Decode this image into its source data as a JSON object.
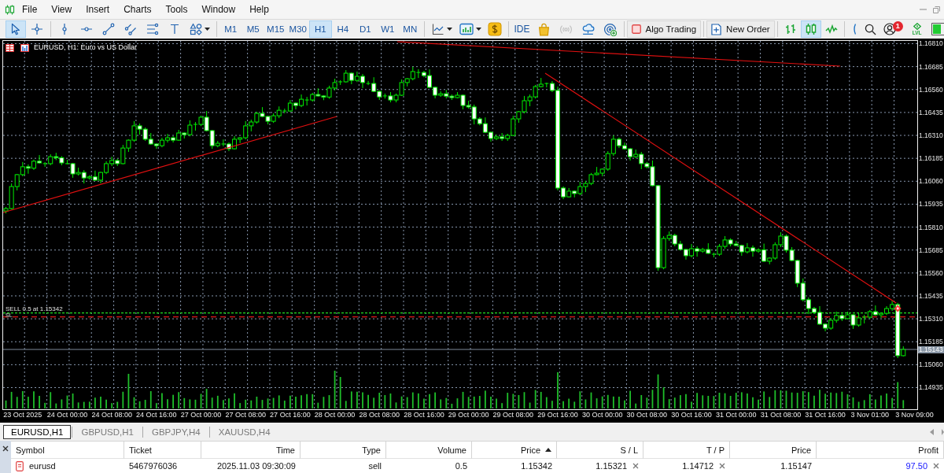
{
  "menu_bar": {
    "items": [
      "File",
      "View",
      "Insert",
      "Charts",
      "Tools",
      "Window",
      "Help"
    ]
  },
  "toolbar": {
    "drawing_tools": [
      {
        "selected": true
      },
      {
        "selected": false
      },
      {
        "selected": false
      },
      {
        "selected": false
      },
      {
        "selected": false
      },
      {
        "selected": false
      },
      {
        "selected": false
      },
      {
        "selected": false
      },
      {
        "selected": false
      }
    ],
    "timeframes": [
      {
        "label": "M1",
        "selected": false
      },
      {
        "label": "M5",
        "selected": false
      },
      {
        "label": "M15",
        "selected": false
      },
      {
        "label": "M30",
        "selected": false
      },
      {
        "label": "H1",
        "selected": true
      },
      {
        "label": "H4",
        "selected": false
      },
      {
        "label": "D1",
        "selected": false
      },
      {
        "label": "W1",
        "selected": false
      },
      {
        "label": "MN",
        "selected": false
      }
    ],
    "services": [
      {
        "label": "IDE",
        "disabled": false
      },
      {
        "disabled": false
      },
      {
        "disabled": true
      },
      {
        "disabled": false
      },
      {
        "disabled": false
      }
    ],
    "algo_trading": {
      "label": "Algo Trading",
      "on": false
    },
    "new_order": {
      "label": "New Order"
    },
    "chart_modes": [
      {
        "selected": false
      },
      {
        "selected": true
      },
      {
        "selected": false
      }
    ],
    "notification_count": "1",
    "level_label": "LVL"
  },
  "chart": {
    "chart_data": {
      "type": "candlestick",
      "title": "EURUSD, H1: Euro vs US Dollar",
      "grid": true,
      "categories": [
        null,
        null,
        null,
        "23 Oct 2025",
        null,
        null,
        null,
        null,
        null,
        null,
        null,
        "24 Oct 00:00",
        null,
        null,
        null,
        null,
        null,
        null,
        null,
        "24 Oct 08:00",
        null,
        null,
        null,
        null,
        null,
        null,
        null,
        "24 Oct 16:00",
        null,
        null,
        null,
        null,
        null,
        null,
        null,
        "27 Oct 00:00",
        null,
        null,
        null,
        null,
        null,
        null,
        null,
        "27 Oct 08:00",
        null,
        null,
        null,
        null,
        null,
        null,
        null,
        "27 Oct 16:00",
        null,
        null,
        null,
        null,
        null,
        null,
        null,
        "28 Oct 00:00",
        null,
        null,
        null,
        null,
        null,
        null,
        null,
        "28 Oct 08:00",
        null,
        null,
        null,
        null,
        null,
        null,
        null,
        "28 Oct 16:00",
        null,
        null,
        null,
        null,
        null,
        null,
        null,
        "29 Oct 00:00",
        null,
        null,
        null,
        null,
        null,
        null,
        null,
        "29 Oct 08:00",
        null,
        null,
        null,
        null,
        null,
        null,
        null,
        "29 Oct 16:00",
        null,
        null,
        null,
        null,
        null,
        null,
        null,
        "30 Oct 00:00",
        null,
        null,
        null,
        null,
        null,
        null,
        null,
        "30 Oct 08:00",
        null,
        null,
        null,
        null,
        null,
        null,
        null,
        "30 Oct 16:00",
        null,
        null,
        null,
        null,
        null,
        null,
        null,
        "31 Oct 00:00",
        null,
        null,
        null,
        null,
        null,
        null,
        null,
        "31 Oct 08:00",
        null,
        null,
        null,
        null,
        null,
        null,
        null,
        "31 Oct 16:00",
        null,
        null,
        null,
        null,
        null,
        null,
        null,
        "3 Nov 01:00",
        null,
        null,
        null,
        null,
        null,
        null,
        null,
        "3 Nov 09:00"
      ],
      "ohlc": [
        [
          1.15898,
          1.1592,
          1.15885,
          1.15911
        ],
        [
          1.15911,
          1.16048,
          1.15907,
          1.16031
        ],
        [
          1.16031,
          1.161,
          1.1601,
          1.16096
        ],
        [
          1.16096,
          1.16165,
          1.16087,
          1.16139
        ],
        [
          1.16139,
          1.16152,
          1.16101,
          1.16131
        ],
        [
          1.16131,
          1.16178,
          1.16122,
          1.16169
        ],
        [
          1.16169,
          1.16203,
          1.16156,
          1.1616
        ],
        [
          1.1616,
          1.16164,
          1.16139,
          1.16156
        ],
        [
          1.16156,
          1.16207,
          1.16147,
          1.16194
        ],
        [
          1.16194,
          1.16215,
          1.16175,
          1.16188
        ],
        [
          1.16188,
          1.16197,
          1.16147,
          1.1616
        ],
        [
          1.1616,
          1.16177,
          1.16152,
          1.16156
        ],
        [
          1.16156,
          1.1616,
          1.16079,
          1.161
        ],
        [
          1.161,
          1.16134,
          1.16091,
          1.16108
        ],
        [
          1.16108,
          1.16121,
          1.16048,
          1.16078
        ],
        [
          1.16078,
          1.16093,
          1.16069,
          1.16084
        ],
        [
          1.16084,
          1.16118,
          1.16062,
          1.16066
        ],
        [
          1.16066,
          1.16112,
          1.16049,
          1.16108
        ],
        [
          1.16108,
          1.16169,
          1.16099,
          1.16156
        ],
        [
          1.16156,
          1.16194,
          1.16143,
          1.16173
        ],
        [
          1.16173,
          1.16182,
          1.16143,
          1.16156
        ],
        [
          1.16156,
          1.16258,
          1.16152,
          1.16241
        ],
        [
          1.16241,
          1.16288,
          1.1622,
          1.16284
        ],
        [
          1.16284,
          1.16388,
          1.16275,
          1.16362
        ],
        [
          1.16362,
          1.16375,
          1.16314,
          1.16344
        ],
        [
          1.16344,
          1.16353,
          1.1628,
          1.16289
        ],
        [
          1.16289,
          1.16323,
          1.16259,
          1.16263
        ],
        [
          1.16263,
          1.16267,
          1.16237,
          1.16254
        ],
        [
          1.16254,
          1.16297,
          1.16245,
          1.16284
        ],
        [
          1.16284,
          1.16318,
          1.16271,
          1.16297
        ],
        [
          1.16297,
          1.16306,
          1.16271,
          1.16284
        ],
        [
          1.16284,
          1.1634,
          1.1628,
          1.16323
        ],
        [
          1.16323,
          1.16327,
          1.16293,
          1.16314
        ],
        [
          1.16314,
          1.16392,
          1.16305,
          1.16366
        ],
        [
          1.16366,
          1.16383,
          1.16336,
          1.1637
        ],
        [
          1.1637,
          1.16418,
          1.16361,
          1.16409
        ],
        [
          1.16409,
          1.16443,
          1.16332,
          1.16336
        ],
        [
          1.16336,
          1.1634,
          1.16237,
          1.16254
        ],
        [
          1.16254,
          1.1628,
          1.16245,
          1.16267
        ],
        [
          1.16267,
          1.16288,
          1.1625,
          1.16263
        ],
        [
          1.16263,
          1.16272,
          1.16224,
          1.16237
        ],
        [
          1.16237,
          1.16306,
          1.16233,
          1.16289
        ],
        [
          1.16289,
          1.16301,
          1.16268,
          1.16297
        ],
        [
          1.16297,
          1.16388,
          1.16288,
          1.16362
        ],
        [
          1.16362,
          1.16396,
          1.16332,
          1.16383
        ],
        [
          1.16383,
          1.16439,
          1.16374,
          1.1643
        ],
        [
          1.1643,
          1.16464,
          1.16409,
          1.16413
        ],
        [
          1.16413,
          1.16417,
          1.1637,
          1.16387
        ],
        [
          1.16387,
          1.1643,
          1.16378,
          1.16417
        ],
        [
          1.16417,
          1.16468,
          1.16404,
          1.16447
        ],
        [
          1.16447,
          1.16456,
          1.1643,
          1.16443
        ],
        [
          1.16443,
          1.16503,
          1.16439,
          1.16486
        ],
        [
          1.16486,
          1.1649,
          1.16452,
          1.16473
        ],
        [
          1.16473,
          1.16533,
          1.16464,
          1.16507
        ],
        [
          1.16507,
          1.1652,
          1.16473,
          1.16503
        ],
        [
          1.16503,
          1.16542,
          1.16494,
          1.16533
        ],
        [
          1.16533,
          1.16567,
          1.16521,
          1.16525
        ],
        [
          1.16525,
          1.16529,
          1.16502,
          1.16519
        ],
        [
          1.16519,
          1.16581,
          1.1651,
          1.16568
        ],
        [
          1.16568,
          1.16619,
          1.16555,
          1.16598
        ],
        [
          1.16598,
          1.16611,
          1.16585,
          1.16602
        ],
        [
          1.16602,
          1.16666,
          1.16598,
          1.16649
        ],
        [
          1.16649,
          1.16653,
          1.16589,
          1.1661
        ],
        [
          1.1661,
          1.16658,
          1.16601,
          1.16632
        ],
        [
          1.16632,
          1.16645,
          1.16568,
          1.16598
        ],
        [
          1.16598,
          1.16607,
          1.16584,
          1.16593
        ],
        [
          1.16593,
          1.16627,
          1.16546,
          1.1655
        ],
        [
          1.1655,
          1.16554,
          1.16503,
          1.1652
        ],
        [
          1.1652,
          1.16538,
          1.16511,
          1.16525
        ],
        [
          1.16525,
          1.16546,
          1.1649,
          1.16503
        ],
        [
          1.16503,
          1.16538,
          1.1649,
          1.16529
        ],
        [
          1.16529,
          1.16615,
          1.16525,
          1.16598
        ],
        [
          1.16598,
          1.16623,
          1.16577,
          1.16619
        ],
        [
          1.16619,
          1.16684,
          1.1661,
          1.16658
        ],
        [
          1.16658,
          1.16671,
          1.16623,
          1.16653
        ],
        [
          1.16653,
          1.16662,
          1.16627,
          1.16636
        ],
        [
          1.16636,
          1.1667,
          1.16568,
          1.16572
        ],
        [
          1.16572,
          1.16576,
          1.16512,
          1.16529
        ],
        [
          1.16529,
          1.1655,
          1.1652,
          1.16537
        ],
        [
          1.16537,
          1.16558,
          1.16511,
          1.16524
        ],
        [
          1.16524,
          1.16533,
          1.16503,
          1.16516
        ],
        [
          1.16516,
          1.16546,
          1.16512,
          1.16529
        ],
        [
          1.16529,
          1.16533,
          1.16452,
          1.16473
        ],
        [
          1.16473,
          1.16499,
          1.16456,
          1.16465
        ],
        [
          1.16465,
          1.16478,
          1.1637,
          1.164
        ],
        [
          1.164,
          1.16409,
          1.16365,
          1.16374
        ],
        [
          1.16374,
          1.16408,
          1.16323,
          1.16327
        ],
        [
          1.16327,
          1.16331,
          1.16276,
          1.16293
        ],
        [
          1.16293,
          1.16315,
          1.16284,
          1.16302
        ],
        [
          1.16302,
          1.16323,
          1.1628,
          1.16293
        ],
        [
          1.16293,
          1.16319,
          1.1628,
          1.1631
        ],
        [
          1.1631,
          1.16417,
          1.16306,
          1.164
        ],
        [
          1.164,
          1.16443,
          1.16379,
          1.16439
        ],
        [
          1.16439,
          1.16525,
          1.1643,
          1.16499
        ],
        [
          1.16499,
          1.16533,
          1.16469,
          1.1652
        ],
        [
          1.1652,
          1.16585,
          1.16511,
          1.16576
        ],
        [
          1.16576,
          1.16623,
          1.16572,
          1.16589
        ],
        [
          1.16589,
          1.16597,
          1.16572,
          1.16593
        ],
        [
          1.16593,
          1.16606,
          1.16546,
          1.16555
        ],
        [
          1.16555,
          1.16576,
          1.1601,
          1.16023
        ],
        [
          1.16023,
          1.16032,
          1.15962,
          1.15975
        ],
        [
          1.15975,
          1.16023,
          1.15971,
          1.16006
        ],
        [
          1.16006,
          1.1601,
          1.15972,
          1.15993
        ],
        [
          1.15993,
          1.16057,
          1.15984,
          1.16031
        ],
        [
          1.16031,
          1.16061,
          1.16001,
          1.16048
        ],
        [
          1.16048,
          1.16105,
          1.16039,
          1.16096
        ],
        [
          1.16096,
          1.16138,
          1.16092,
          1.16104
        ],
        [
          1.16104,
          1.1613,
          1.16087,
          1.16126
        ],
        [
          1.16126,
          1.16224,
          1.16117,
          1.16211
        ],
        [
          1.16211,
          1.1631,
          1.16198,
          1.16289
        ],
        [
          1.16289,
          1.16298,
          1.16241,
          1.16254
        ],
        [
          1.16254,
          1.16271,
          1.16233,
          1.16237
        ],
        [
          1.16237,
          1.16241,
          1.16173,
          1.16194
        ],
        [
          1.16194,
          1.16233,
          1.16185,
          1.16207
        ],
        [
          1.16207,
          1.1622,
          1.16126,
          1.16156
        ],
        [
          1.16156,
          1.16165,
          1.1613,
          1.16139
        ],
        [
          1.16139,
          1.16173,
          1.16032,
          1.16036
        ],
        [
          1.16036,
          1.1604,
          1.15572,
          1.15589
        ],
        [
          1.15589,
          1.15761,
          1.1558,
          1.15748
        ],
        [
          1.15748,
          1.15786,
          1.15735,
          1.15765
        ],
        [
          1.15765,
          1.15774,
          1.15705,
          1.15718
        ],
        [
          1.15718,
          1.15735,
          1.15684,
          1.15688
        ],
        [
          1.15688,
          1.15692,
          1.15633,
          1.15654
        ],
        [
          1.15654,
          1.15718,
          1.15645,
          1.15692
        ],
        [
          1.15692,
          1.15705,
          1.15649,
          1.15679
        ],
        [
          1.15679,
          1.15697,
          1.1567,
          1.15688
        ],
        [
          1.15688,
          1.15722,
          1.15663,
          1.15667
        ],
        [
          1.15667,
          1.15671,
          1.15645,
          1.15662
        ],
        [
          1.15662,
          1.15718,
          1.15653,
          1.15705
        ],
        [
          1.15705,
          1.15761,
          1.15692,
          1.1574
        ],
        [
          1.1574,
          1.15749,
          1.15705,
          1.15718
        ],
        [
          1.15718,
          1.15735,
          1.15706,
          1.1571
        ],
        [
          1.1571,
          1.15714,
          1.15654,
          1.15675
        ],
        [
          1.15675,
          1.15723,
          1.15666,
          1.15697
        ],
        [
          1.15697,
          1.1571,
          1.15649,
          1.15679
        ],
        [
          1.15679,
          1.15695,
          1.1567,
          1.15686
        ],
        [
          1.15686,
          1.1572,
          1.1562,
          1.15624
        ],
        [
          1.15624,
          1.15645,
          1.15607,
          1.15641
        ],
        [
          1.15641,
          1.15727,
          1.15632,
          1.15714
        ],
        [
          1.15714,
          1.15782,
          1.15701,
          1.15761
        ],
        [
          1.15761,
          1.1577,
          1.15671,
          1.15684
        ],
        [
          1.15684,
          1.15701,
          1.15624,
          1.15628
        ],
        [
          1.15628,
          1.15632,
          1.15483,
          1.15504
        ],
        [
          1.15504,
          1.1553,
          1.15405,
          1.15414
        ],
        [
          1.15414,
          1.15427,
          1.15336,
          1.15366
        ],
        [
          1.15366,
          1.15375,
          1.15336,
          1.15345
        ],
        [
          1.15345,
          1.15379,
          1.15277,
          1.15281
        ],
        [
          1.15281,
          1.15285,
          1.15242,
          1.15259
        ],
        [
          1.15259,
          1.15315,
          1.1525,
          1.15302
        ],
        [
          1.15302,
          1.15349,
          1.15289,
          1.15328
        ],
        [
          1.15328,
          1.15337,
          1.15298,
          1.15311
        ],
        [
          1.15311,
          1.15349,
          1.15307,
          1.15332
        ],
        [
          1.15332,
          1.15336,
          1.15255,
          1.15276
        ],
        [
          1.15276,
          1.15341,
          1.15267,
          1.15315
        ],
        [
          1.15315,
          1.15332,
          1.15285,
          1.15319
        ],
        [
          1.15319,
          1.15358,
          1.1531,
          1.15349
        ],
        [
          1.15349,
          1.15383,
          1.15328,
          1.15332
        ],
        [
          1.15332,
          1.15344,
          1.15315,
          1.1534
        ],
        [
          1.1534,
          1.15379,
          1.15331,
          1.15366
        ],
        [
          1.15366,
          1.15409,
          1.15353,
          1.15388
        ],
        [
          1.15388,
          1.15397,
          1.15096,
          1.15109
        ],
        [
          1.15109,
          1.1516,
          1.15105,
          1.15143
        ],
        null,
        null
      ],
      "ylim": [
        1.14817,
        1.16825
      ],
      "yticks": [
        {
          "value": 1.1681,
          "label": "1.16810"
        },
        {
          "value": 1.16685,
          "label": "1.16685"
        },
        {
          "value": 1.1656,
          "label": "1.16560"
        },
        {
          "value": 1.16435,
          "label": "1.16435"
        },
        {
          "value": 1.1631,
          "label": "1.16310"
        },
        {
          "value": 1.16185,
          "label": "1.16185"
        },
        {
          "value": 1.1606,
          "label": "1.16060"
        },
        {
          "value": 1.15935,
          "label": "1.15935"
        },
        {
          "value": 1.1581,
          "label": "1.15810"
        },
        {
          "value": 1.15685,
          "label": "1.15685"
        },
        {
          "value": 1.1556,
          "label": "1.15560"
        },
        {
          "value": 1.15435,
          "label": "1.15435"
        },
        {
          "value": 1.1531,
          "label": "1.15310"
        },
        {
          "value": 1.15185,
          "label": "1.15185"
        },
        {
          "value": 1.1506,
          "label": "1.15060"
        },
        {
          "value": 1.14935,
          "label": "1.14935"
        }
      ],
      "ref_lines": [
        {
          "axis": "y",
          "value": 1.15342,
          "label": "SELL 0.5 at 1.15342",
          "color": "#22dd22"
        },
        {
          "axis": "y",
          "value": 1.15321,
          "label": "SL",
          "color": "#e01818"
        },
        {
          "axis": "y",
          "value": 1.15143,
          "label": "1.15143",
          "color": "#7d8a99"
        }
      ]
    }
  },
  "chart_tabs": [
    {
      "label": "EURUSD,H1",
      "selected": true
    },
    {
      "label": "GBPUSD,H1",
      "selected": false
    },
    {
      "label": "GBPJPY,H4",
      "selected": false
    },
    {
      "label": "XAUUSD,H4",
      "selected": false
    }
  ],
  "trade_table": {
    "columns": [
      {
        "label": "Symbol",
        "sorted": false
      },
      {
        "label": "Ticket",
        "sorted": false
      },
      {
        "label": "Time",
        "sorted": false
      },
      {
        "label": "Type",
        "sorted": false
      },
      {
        "label": "Volume",
        "sorted": false
      },
      {
        "label": "Price",
        "sorted": true
      },
      {
        "label": "S / L",
        "sorted": false
      },
      {
        "label": "T / P",
        "sorted": false
      },
      {
        "label": "Price",
        "sorted": false
      },
      {
        "label": "Profit",
        "sorted": false
      }
    ],
    "rows": [
      {
        "cells": [
          "eurusd",
          "5467976036",
          "2025.11.03 09:30:09",
          "sell",
          "0.5",
          "1.15342",
          "1.15321",
          "1.14712",
          "1.15147",
          "97.50"
        ]
      }
    ]
  }
}
